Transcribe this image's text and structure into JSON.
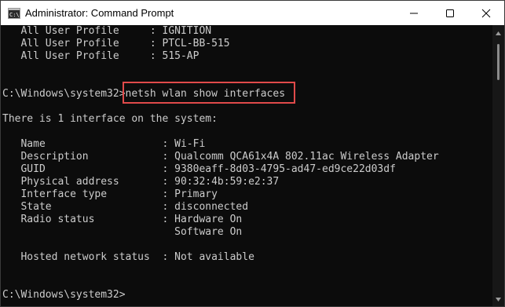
{
  "window": {
    "title": "Administrator: Command Prompt",
    "icon": "cmd-icon",
    "controls": [
      "minimize-icon",
      "maximize-icon",
      "close-icon"
    ]
  },
  "console": {
    "lines": [
      "   All User Profile     : IGNITION",
      "   All User Profile     : PTCL-BB-515",
      "   All User Profile     : 515-AP",
      "",
      "",
      "C:\\Windows\\system32>netsh wlan show interfaces",
      "",
      "There is 1 interface on the system:",
      "",
      "   Name                   : Wi-Fi",
      "   Description            : Qualcomm QCA61x4A 802.11ac Wireless Adapter",
      "   GUID                   : 9380eaff-8d03-4795-ad47-ed9ce22d03df",
      "   Physical address       : 90:32:4b:59:e2:37",
      "   Interface type         : Primary",
      "   State                  : disconnected",
      "   Radio status           : Hardware On",
      "                            Software On",
      "",
      "   Hosted network status  : Not available",
      "",
      "",
      "C:\\Windows\\system32>"
    ],
    "highlight_color": "#e04a4a"
  },
  "scrollbar": {
    "up_icon": "scroll-up-icon",
    "down_icon": "scroll-down-icon"
  }
}
